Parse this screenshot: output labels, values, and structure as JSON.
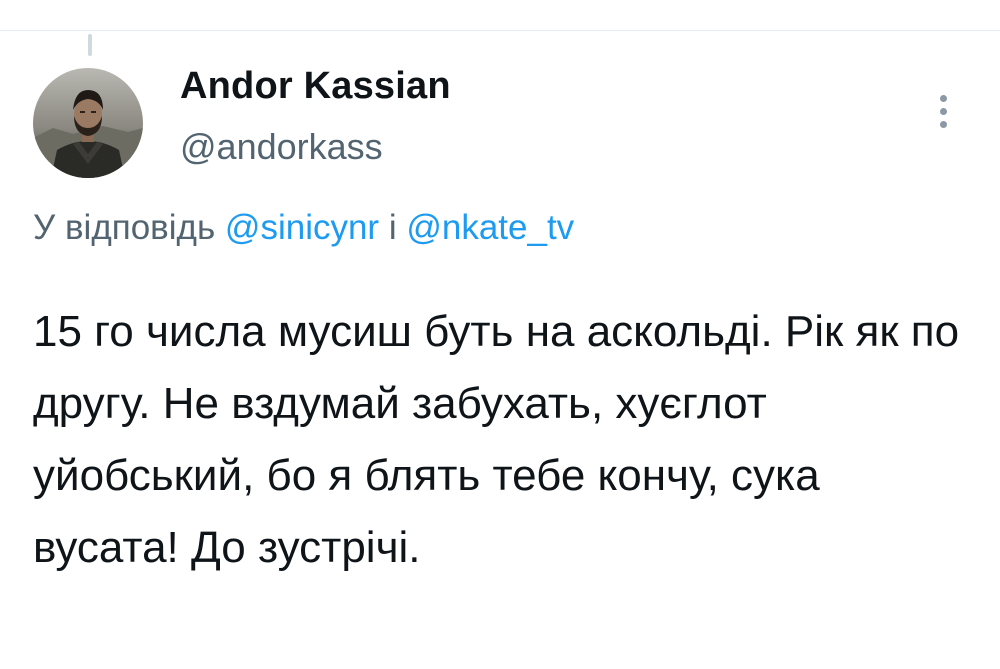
{
  "tweet": {
    "author": {
      "display_name": "Andor Kassian",
      "handle": "@andorkass",
      "avatar_icon": "person-photo-avatar"
    },
    "reply_context": {
      "prefix": "У відповідь ",
      "mention_1": "@sinicynr",
      "conjunction": " і ",
      "mention_2": "@nkate_tv"
    },
    "text": "15 го числа мусиш буть на аскольді. Рік як по другу. Не вздумай забухать, хуєглот уйобський, бо я блять тебе кончу, сука вусата! До зустрічі.",
    "more_icon": "vertical-ellipsis-icon"
  },
  "colors": {
    "text_primary": "#0f1419",
    "text_secondary": "#536471",
    "link": "#1d9bf0",
    "divider": "#e6ecf0"
  }
}
